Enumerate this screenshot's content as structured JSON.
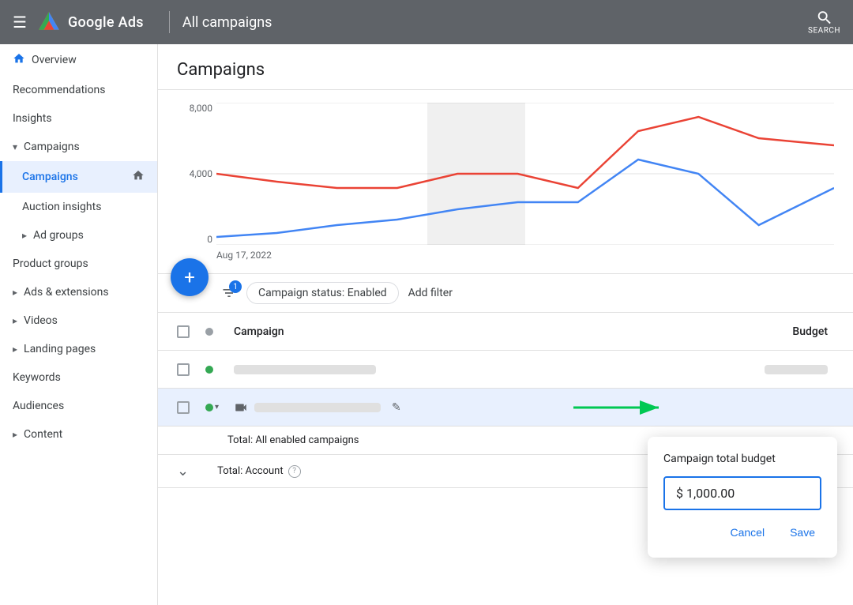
{
  "topbar": {
    "brand": "Google Ads",
    "title": "All campaigns",
    "search_label": "SEARCH"
  },
  "sidebar": {
    "items": [
      {
        "id": "overview",
        "label": "Overview",
        "icon": "home",
        "active": false,
        "home_icon": true,
        "indent": 0
      },
      {
        "id": "recommendations",
        "label": "Recommendations",
        "icon": "",
        "active": false,
        "indent": 0
      },
      {
        "id": "insights",
        "label": "Insights",
        "icon": "",
        "active": false,
        "indent": 0
      },
      {
        "id": "campaigns-group",
        "label": "Campaigns",
        "icon": "chevron-down",
        "active": false,
        "indent": 0,
        "expanded": true
      },
      {
        "id": "campaigns",
        "label": "Campaigns",
        "icon": "home",
        "active": true,
        "indent": 1
      },
      {
        "id": "auction-insights",
        "label": "Auction insights",
        "icon": "",
        "active": false,
        "indent": 1
      },
      {
        "id": "ad-groups",
        "label": "Ad groups",
        "icon": "chevron",
        "active": false,
        "indent": 1
      },
      {
        "id": "product-groups",
        "label": "Product groups",
        "icon": "",
        "active": false,
        "indent": 0
      },
      {
        "id": "ads-extensions",
        "label": "Ads & extensions",
        "icon": "chevron",
        "active": false,
        "indent": 0
      },
      {
        "id": "videos",
        "label": "Videos",
        "icon": "chevron",
        "active": false,
        "indent": 0
      },
      {
        "id": "landing-pages",
        "label": "Landing pages",
        "icon": "chevron",
        "active": false,
        "indent": 0
      },
      {
        "id": "keywords",
        "label": "Keywords",
        "icon": "",
        "active": false,
        "indent": 0
      },
      {
        "id": "audiences",
        "label": "Audiences",
        "icon": "",
        "active": false,
        "indent": 0
      },
      {
        "id": "content",
        "label": "Content",
        "icon": "chevron",
        "active": false,
        "indent": 0
      }
    ]
  },
  "page": {
    "title": "Campaigns"
  },
  "chart": {
    "y_labels": [
      "8,000",
      "4,000",
      "0"
    ],
    "x_label": "Aug 17, 2022"
  },
  "filter_bar": {
    "badge": "1",
    "chip_label": "Campaign status: Enabled",
    "add_filter_label": "Add filter"
  },
  "table": {
    "col_campaign": "Campaign",
    "col_budget": "Budget",
    "rows": [
      {
        "id": "row1",
        "status": "green",
        "has_icon": false,
        "highlighted": false
      },
      {
        "id": "row2",
        "status": "green",
        "has_icon": true,
        "highlighted": true
      }
    ],
    "total_label": "Total: All enabled campaigns",
    "account_label": "Total: Account"
  },
  "budget_popup": {
    "title": "Campaign total budget",
    "value": "$ 1,000.00",
    "cancel_label": "Cancel",
    "save_label": "Save"
  }
}
